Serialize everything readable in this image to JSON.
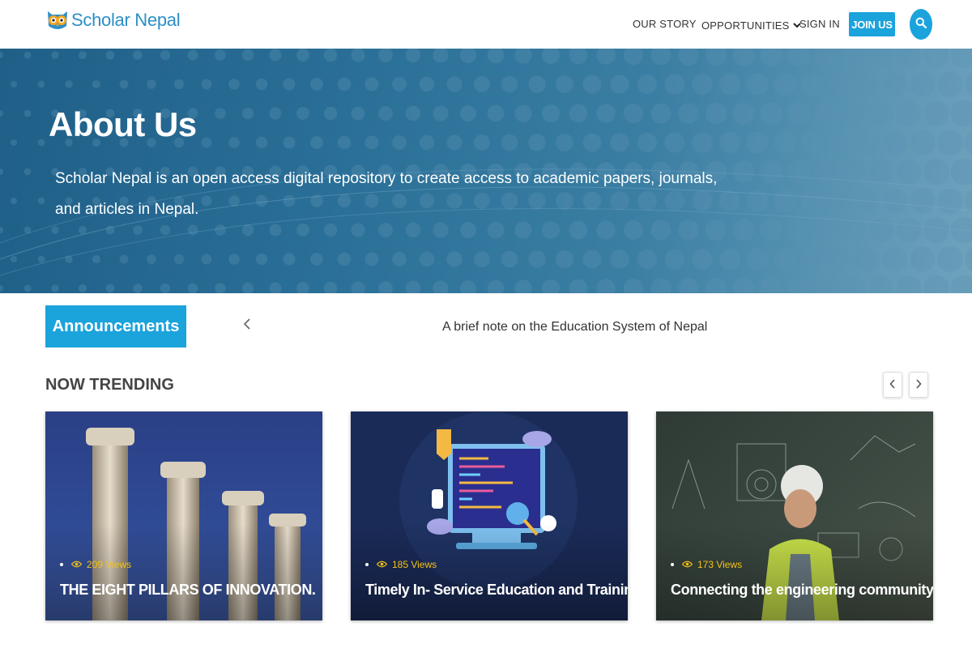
{
  "brand": {
    "name": "Scholar Nepal",
    "color": "#2c8fc6",
    "accent": "#1ba3dc"
  },
  "nav": {
    "our_story": "OUR STORY",
    "opportunities": "OPPORTUNITIES",
    "opportunities_icon": "chevron-down-icon",
    "sign_in": "SIGN IN",
    "join_us": "JOIN US",
    "search_icon": "search-icon"
  },
  "hero": {
    "title": "About Us",
    "description": "Scholar Nepal is an open access digital repository to create access to academic papers, journals, and articles in Nepal."
  },
  "announcements": {
    "label": "Announcements",
    "prev_icon": "chevron-left-icon",
    "current": "A brief note on the Education System of Nepal"
  },
  "trending": {
    "heading": "NOW TRENDING",
    "prev_icon": "chevron-left-icon",
    "next_icon": "chevron-right-icon",
    "cards": [
      {
        "views": "209 Views",
        "title": "THE EIGHT PILLARS OF INNOVATION."
      },
      {
        "views": "185 Views",
        "title": "Timely In- Service Education and Training"
      },
      {
        "views": "173 Views",
        "title": "Connecting the engineering community"
      }
    ],
    "views_color": "#f3c316"
  }
}
